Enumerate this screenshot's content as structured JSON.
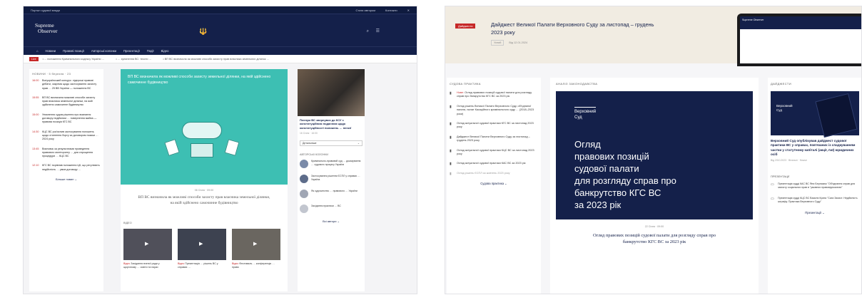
{
  "left": {
    "topline": {
      "left_text": "Портал судової влади",
      "links": [
        "Стати автором",
        "Контакти",
        "✕"
      ]
    },
    "logo": {
      "line1": "Supreme",
      "line2": "Observer"
    },
    "crest": "🔱",
    "header_icons": [
      "⌕",
      "☰"
    ],
    "nav": [
      "⌂",
      "Новини",
      "Правові позиції",
      "Авторські колонки",
      "Презентації",
      "Події",
      "Відео"
    ],
    "ticker": {
      "badge": "Live",
      "items": [
        "• ... положення Кримінального кодексу України …",
        "• … зупинення ВС: тексти …",
        "• ВП ВС визначила як можливі способи захисту прав власника земельних ділянок …"
      ]
    },
    "news": {
      "heading": "НОВИНИ · 5 березня · 23",
      "items": [
        {
          "time": "16:00",
          "text": "Всеукраїнський конкурс: лідерські правові дебати, зокрема щодо застосування захисту прав … 25 ВВ України — положення ВС"
        },
        {
          "time": "15:55",
          "text": "ВП ВС визначила можливі способи захисту прав власника земельної ділянки, на якій здійснено самочинне будівництво"
        },
        {
          "time": "15:00",
          "text": "Уникнення судом рішення про визнання договору недійсним … повернення майна — правова позиція КГС ВС"
        },
        {
          "time": "14:30",
          "text": "КЦС ВС роз'яснив застосування положень щодо стягнення боргу за договором позики … 2024 року"
        },
        {
          "time": "13:45",
          "text": "Висновок за результатами проведення правового моніторингу … для спрощення процедури … КЦС ВС"
        },
        {
          "time": "12:10",
          "text": "КГС ВС порівняв положення ЦК, що регулюють недійсність … умов договору …"
        }
      ],
      "more": "Більше новин ⌄"
    },
    "hero": {
      "caption": "ВП ВС визначила як можливі способи захисту земельної ділянки, на якій здійснено самочинне будівництво",
      "date": "06 Січня · 09:00",
      "title": "ВП ВС визначила як можливі способи захисту прав власника земельної ділянки, на якій здійснено самочинне будівництво"
    },
    "video": {
      "heading": "ВІДЕО",
      "items": [
        {
          "tag": "Відео",
          "text": "Засідання вченої ради у щорічному … освіти та науки"
        },
        {
          "tag": "Відео",
          "text": "Презентація … рішень ВС у справах …"
        },
        {
          "tag": "Відео",
          "text": "Фестиваль … конференція … право"
        }
      ]
    },
    "side": {
      "photo_title": "Пленум ВС звернувся до КСУ з конституційним поданням щодо конституційності положень … пенсії",
      "photo_date": "16 Січня · 16:00",
      "more": "Детальніше",
      "authors_heading": "АВТОРСЬКІ КОЛОНКИ",
      "authors": [
        "Кримінально-правовий суд … доказування … судового процесу України",
        "Застосування рішення ЄСПЛ у справах … Україна",
        "Як судочинство … правового … України",
        "Засідання практики … ВС"
      ],
      "all_authors": "Всі автори ⌄"
    }
  },
  "right": {
    "digest_badge": "Дайджести",
    "banner_title": "Дайджест Великої Палати Верховного Суду за листопад – грудень 2023 року",
    "banner_meta": [
      "Усний",
      "Від 12.01.2024"
    ],
    "laptop_text": "Supreme Observer",
    "col1": {
      "heading": "СУДОВА ПРАКТИКА",
      "items": [
        {
          "badge": "Нове:",
          "text": "Огляд правових позицій судової палати для розгляду справ про банкрутство КГС ВС за 2023 рік"
        },
        {
          "badge": "",
          "text": "Огляд рішень Великої Палати Верховного Суду, об'єднаної палати, палат Касаційного кримінального суду … (2018–2023 роки)"
        },
        {
          "badge": "",
          "text": "Огляд актуальної судової практики КГС ВС за листопад 2023 року"
        },
        {
          "badge": "",
          "text": "Дайджест Великої Палати Верховного Суду за листопад – грудень 2023 року"
        },
        {
          "badge": "",
          "text": "Огляд актуальної судової практики КЦС ВС за листопад 2023 року"
        },
        {
          "badge": "",
          "text": "Огляд актуальної судової практики КАС ВС за 2023 рік"
        },
        {
          "badge": "",
          "text": "Огляд рішень ЄСПЛ за жовтень 2023 року"
        }
      ],
      "more": "Судова практика ⌄"
    },
    "col2": {
      "heading": "АНАЛІЗ ЗАКОНОДАВСТВА",
      "org_line1": "Верховний",
      "org_line2": "Суд",
      "big_lines": [
        "Огляд",
        "правових позицій",
        "судової палати",
        "для розгляду справ про",
        "банкрутство КГС ВС",
        "за 2023 рік"
      ],
      "date": "22 Січня · 09:00",
      "title": "Огляд правових позицій судової палати для розгляду справ про банкрутство КГС ВС за 2023 рік"
    },
    "col3": {
      "heading": "ДАЙДЖЕСТИ",
      "org_line1": "Верховний",
      "org_line2": "Суд",
      "title": "Верховний Суд опублікував дайджест судової практики ВС у справах, пов'язаних із спадкуванням частки у статутному капіталі (акції, паї) юридичних осіб",
      "date": "Від 2010.2023 · Вітальні · Нижче",
      "pres_heading": "ПРЕЗЕНТАЦІЇ",
      "pres": [
        "Презентація судді КАС ВС Яни Берназюк \"Об'єднання справ для захисту соціальних прав в \"умовних правовідносинах\"",
        "Презентація судді КЦС ВС Васили Крата \"Сага Захист. Недійсність штрафу. Практика Верховного Суду\""
      ],
      "more": "Презентації ⌄"
    }
  }
}
